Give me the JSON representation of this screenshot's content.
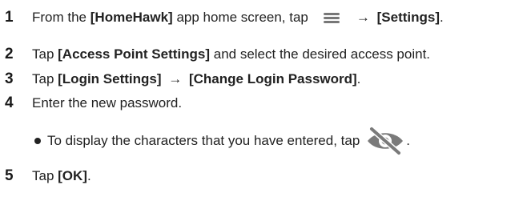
{
  "steps": [
    {
      "number": "1",
      "pre": "From the ",
      "bold1": "[HomeHawk]",
      "mid": " app home screen, tap",
      "arrow": "→",
      "bold2": "[Settings]",
      "post": "."
    },
    {
      "number": "2",
      "pre": "Tap ",
      "bold1": "[Access Point Settings]",
      "post": " and select the desired access point."
    },
    {
      "number": "3",
      "pre": "Tap ",
      "bold1": "[Login Settings]",
      "arrow": "→",
      "bold2": "[Change Login Password]",
      "post": "."
    },
    {
      "number": "4",
      "text": "Enter the new password."
    },
    {
      "number": "5",
      "pre": "Tap ",
      "bold1": "[OK]",
      "post": "."
    }
  ],
  "bullet": {
    "text": "To display the characters that you have entered, tap",
    "post": "."
  },
  "icons": {
    "menu": "hamburger-menu-icon",
    "eye": "eye-slash-icon"
  },
  "colors": {
    "text": "#222222",
    "icon": "#777777"
  }
}
